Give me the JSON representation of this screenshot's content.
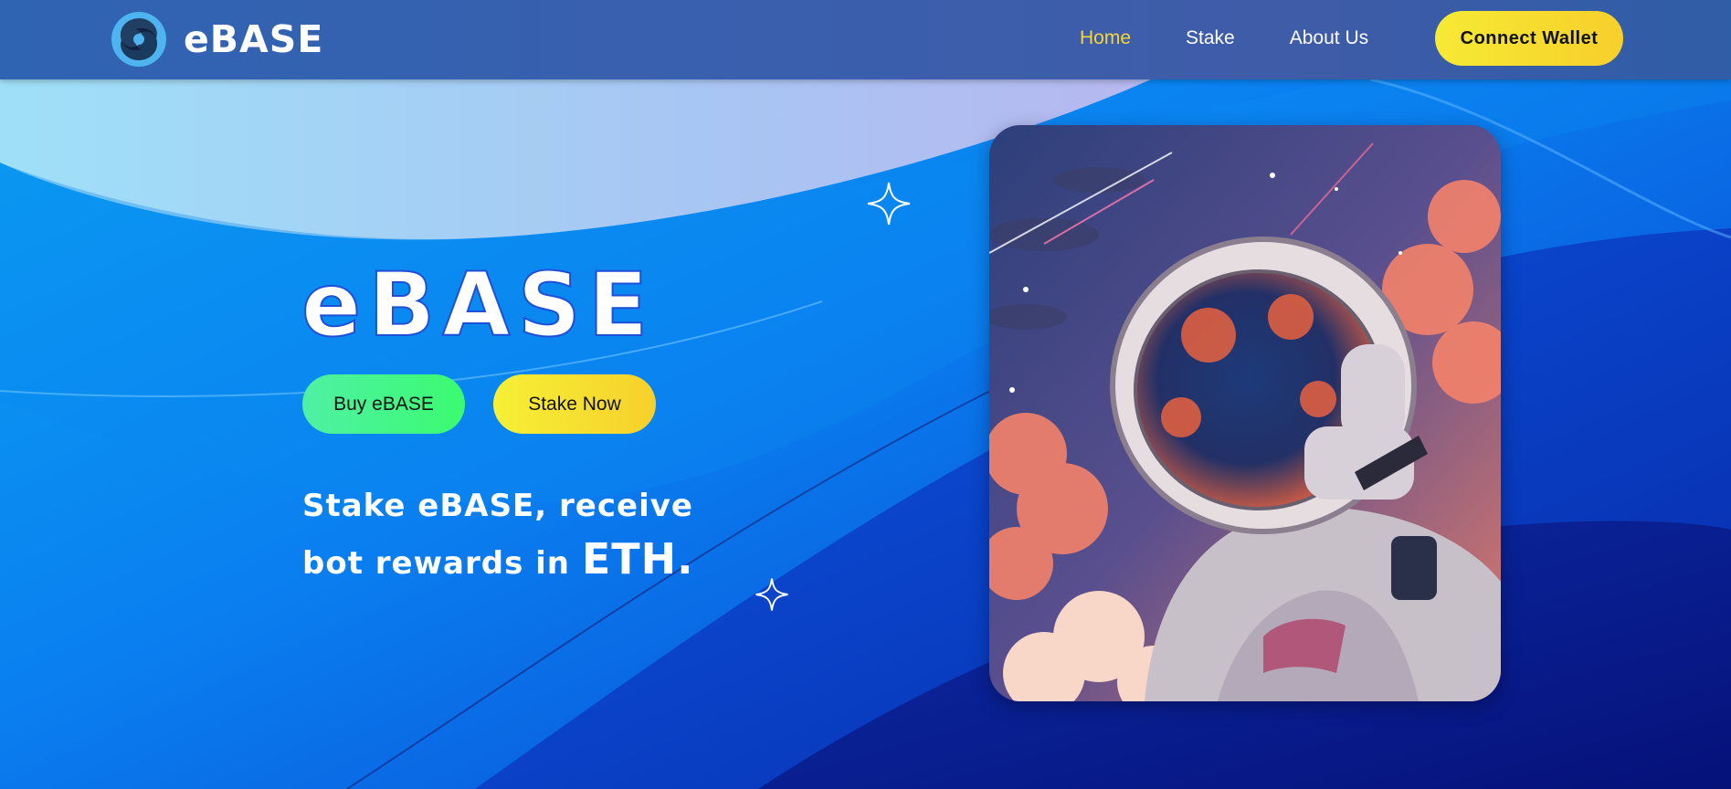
{
  "header": {
    "brand": "eBASE",
    "nav": [
      {
        "label": "Home",
        "active": true
      },
      {
        "label": "Stake",
        "active": false
      },
      {
        "label": "About Us",
        "active": false
      }
    ],
    "connect_label": "Connect Wallet"
  },
  "hero": {
    "title": "eBASE",
    "buy_label": "Buy eBASE",
    "stake_label": "Stake Now",
    "tagline_part1": "Stake eBASE, receive",
    "tagline_part2": "bot rewards in ",
    "tagline_emphasis": "ETH."
  },
  "colors": {
    "accent_yellow": "#f7d92f",
    "accent_green": "#3df58a",
    "nav_active": "#f5d53a",
    "header_bg": "#3a5fad"
  },
  "icons": {
    "logo": "swirl-logo-icon",
    "sparkle": "four-point-star-icon"
  }
}
